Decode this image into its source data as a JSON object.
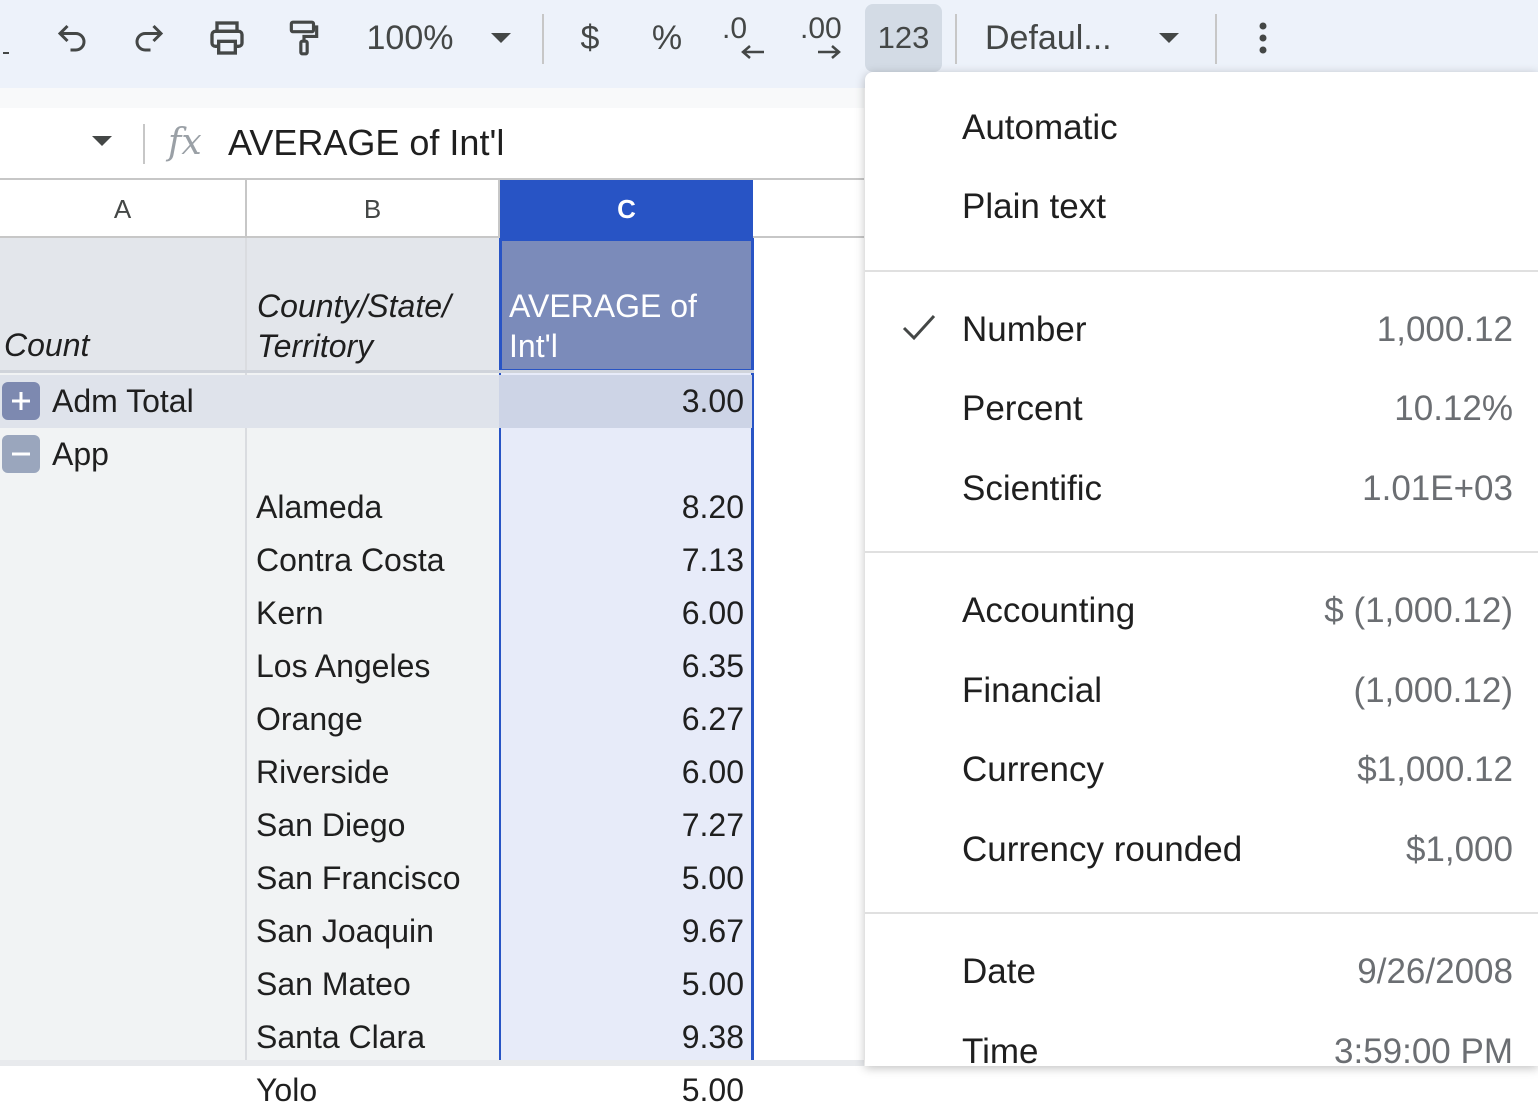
{
  "toolbar": {
    "zoom": "100%",
    "currency_symbol": "$",
    "percent_symbol": "%",
    "decrease_decimal": ".0",
    "increase_decimal": ".00",
    "more_formats": "123",
    "font": "Defaul...",
    "icons": [
      "undo-icon",
      "redo-icon",
      "print-icon",
      "paint-format-icon",
      "chevron-down-icon",
      "more-vert-icon"
    ]
  },
  "formula_bar": {
    "fx": "fx",
    "content": "AVERAGE of Int'l"
  },
  "columns": [
    "A",
    "B",
    "C"
  ],
  "selected_column": "C",
  "pivot": {
    "header_a": "Count",
    "header_b_line1": "County/State/",
    "header_b_line2": "Territory",
    "header_c_line1": "AVERAGE of",
    "header_c_line2": "Int'l",
    "groups": [
      {
        "label": "Adm Total",
        "toggle": "+",
        "expanded": false,
        "value": "3.00"
      },
      {
        "label": "App",
        "toggle": "−",
        "expanded": true
      }
    ],
    "rows": [
      {
        "county": "Alameda",
        "value": "8.20"
      },
      {
        "county": "Contra Costa",
        "value": "7.13"
      },
      {
        "county": "Kern",
        "value": "6.00"
      },
      {
        "county": "Los Angeles",
        "value": "6.35"
      },
      {
        "county": "Orange",
        "value": "6.27"
      },
      {
        "county": "Riverside",
        "value": "6.00"
      },
      {
        "county": "San Diego",
        "value": "7.27"
      },
      {
        "county": "San Francisco",
        "value": "5.00"
      },
      {
        "county": "San Joaquin",
        "value": "9.67"
      },
      {
        "county": "San Mateo",
        "value": "5.00"
      },
      {
        "county": "Santa Clara",
        "value": "9.38"
      },
      {
        "county": "Yolo",
        "value": "5.00"
      }
    ]
  },
  "format_menu": {
    "items": [
      {
        "label": "Automatic",
        "sample": ""
      },
      {
        "label": "Plain text",
        "sample": ""
      },
      {
        "label": "Number",
        "sample": "1,000.12",
        "checked": true
      },
      {
        "label": "Percent",
        "sample": "10.12%"
      },
      {
        "label": "Scientific",
        "sample": "1.01E+03"
      },
      {
        "label": "Accounting",
        "sample": "$ (1,000.12)"
      },
      {
        "label": "Financial",
        "sample": "(1,000.12)"
      },
      {
        "label": "Currency",
        "sample": "$1,000.12"
      },
      {
        "label": "Currency rounded",
        "sample": "$1,000"
      },
      {
        "label": "Date",
        "sample": "9/26/2008"
      },
      {
        "label": "Time",
        "sample": "3:59:00 PM"
      }
    ]
  },
  "colors": {
    "toolbar_bg": "#edf2fa",
    "selected_col_header": "#2854c5",
    "selected_header_cell": "#7b8bba",
    "selected_col_fill": "#e7ebf9",
    "total_row": "#dfe3eb",
    "pivot_header": "#e3e6eb"
  }
}
